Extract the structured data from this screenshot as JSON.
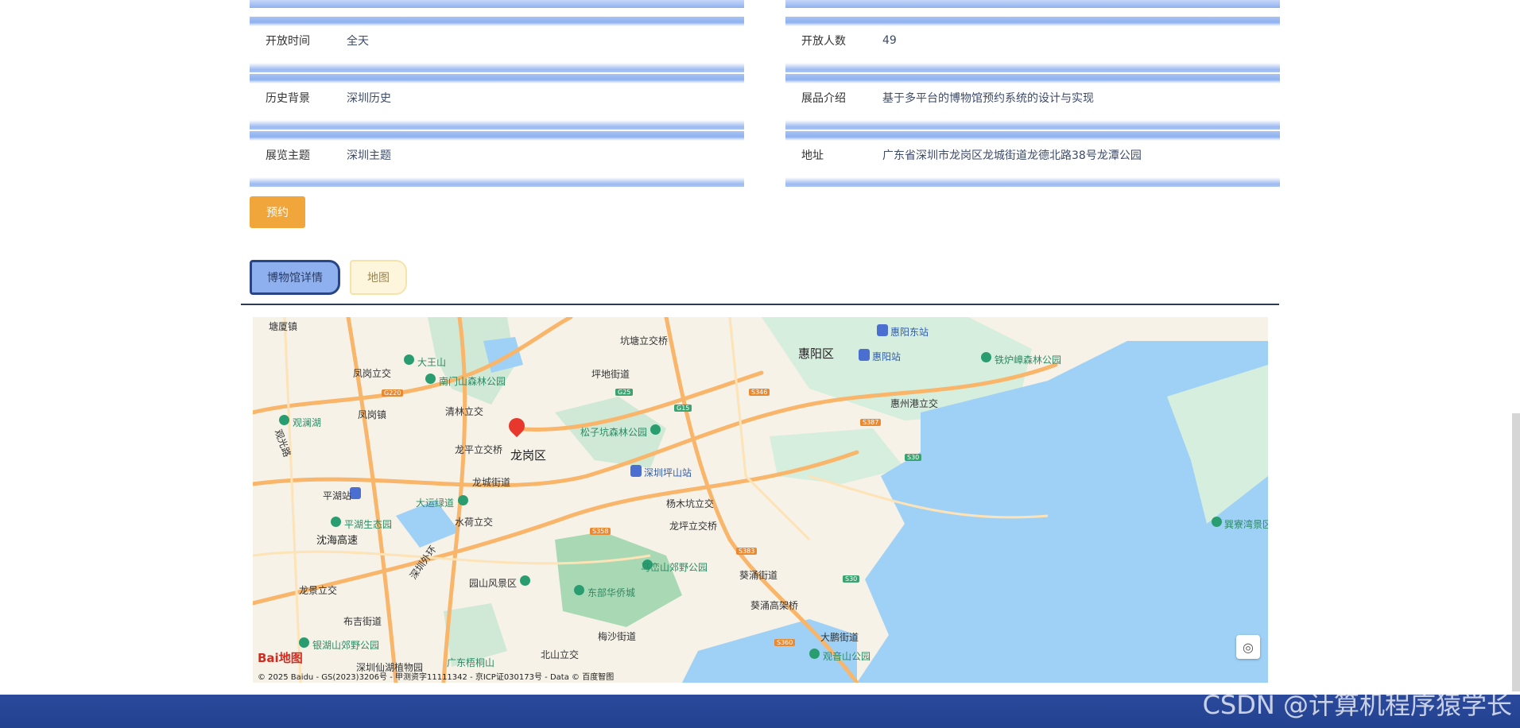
{
  "details": {
    "left": [
      {
        "label": "开放时间",
        "value": "全天"
      },
      {
        "label": "历史背景",
        "value": "深圳历史"
      },
      {
        "label": "展览主题",
        "value": "深圳主题"
      }
    ],
    "right": [
      {
        "label": "开放人数",
        "value": "49"
      },
      {
        "label": "展品介绍",
        "value": "基于多平台的博物馆预约系统的设计与实现"
      },
      {
        "label": "地址",
        "value": "广东省深圳市龙岗区龙城街道龙德北路38号龙潭公园"
      }
    ]
  },
  "reserve_button": "预约",
  "tabs": [
    {
      "label": "博物馆详情",
      "active": true
    },
    {
      "label": "地图",
      "active": false
    }
  ],
  "map": {
    "districts": [
      "龙岗区",
      "惠阳区"
    ],
    "places": [
      "塘厦镇",
      "凤岗立交",
      "大王山",
      "南门山森林公园",
      "凤岗镇",
      "观澜湖",
      "清林立交",
      "坑塘立交桥",
      "坪地街道",
      "龙平立交桥",
      "松子坑森林公园",
      "龙城街道",
      "深圳坪山站",
      "大运绿道",
      "水荷立交",
      "平湖站",
      "平湖生态园",
      "杨木坑立交",
      "沈海高速",
      "龙坪立交桥",
      "马峦山郊野公园",
      "东部华侨城",
      "园山风景区",
      "龙景立交",
      "布吉街道",
      "葵涌街道",
      "葵涌高架桥",
      "梅沙街道",
      "北山立交",
      "银湖山郊野公园",
      "深圳仙湖植物园",
      "广东梧桐山",
      "大鹏街道",
      "观音山公园",
      "惠阳东站",
      "惠阳站",
      "铁炉嶂森林公园",
      "惠州港立交",
      "巽寮湾景区",
      "观光路",
      "深圳外环"
    ],
    "copyright": "© 2025 Baidu - GS(2023)3206号 - 甲测资字11111342 - 京ICP证030173号 - Data © 百度智图",
    "logo_text": "Bai地图"
  },
  "watermark": "CSDN @计算机程序猿学长"
}
